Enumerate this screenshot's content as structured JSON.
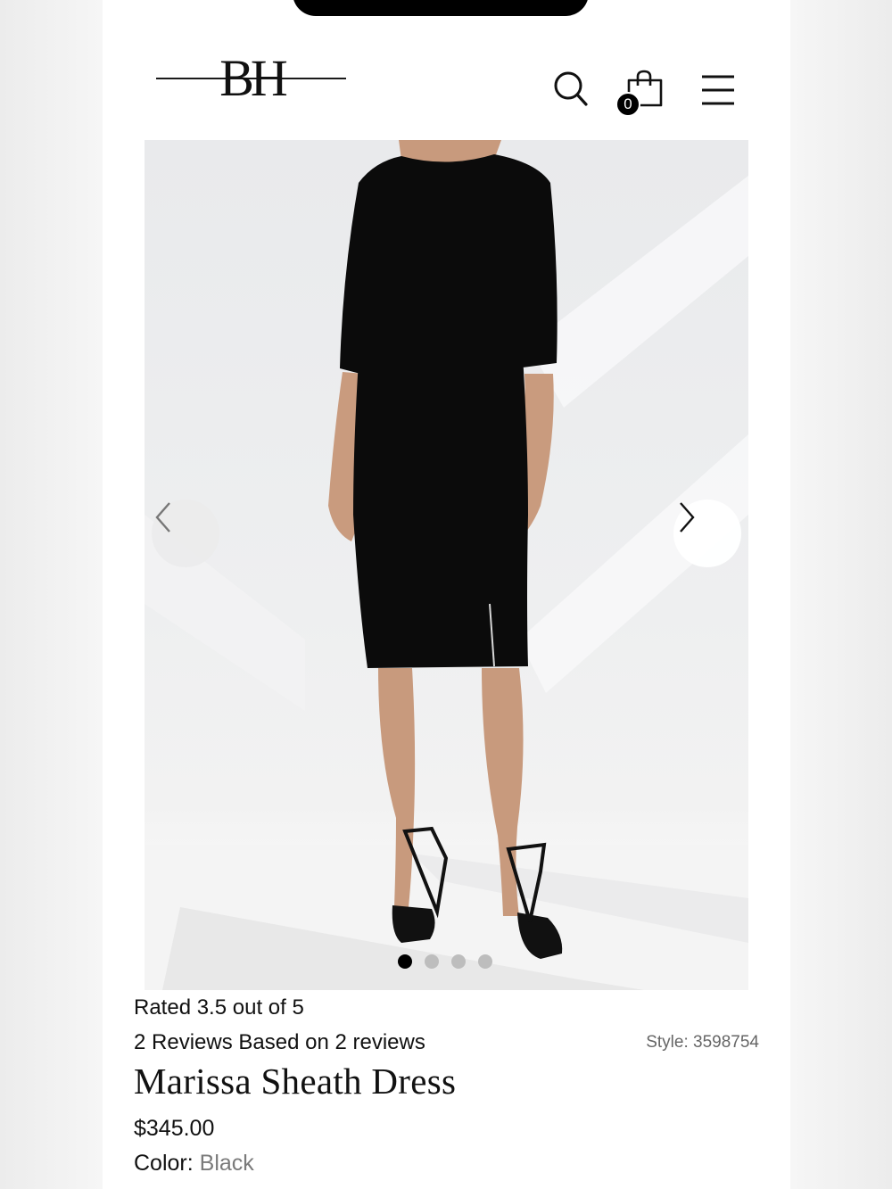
{
  "header": {
    "logo_text": "BH",
    "cart_count": "0"
  },
  "icons": {
    "search": "search-icon",
    "cart": "shopping-bag-icon",
    "menu": "hamburger-menu-icon",
    "prev": "chevron-left-icon",
    "next": "chevron-right-icon"
  },
  "carousel": {
    "slide_count": 4,
    "active_index": 0
  },
  "product": {
    "rating_text": "Rated 3.5 out of 5",
    "reviews_text": "2 Reviews Based on 2 reviews",
    "style_text": "Style: 3598754",
    "title": "Marissa Sheath Dress",
    "price": "$345.00",
    "color_label": "Color:",
    "color_value": "Black"
  }
}
